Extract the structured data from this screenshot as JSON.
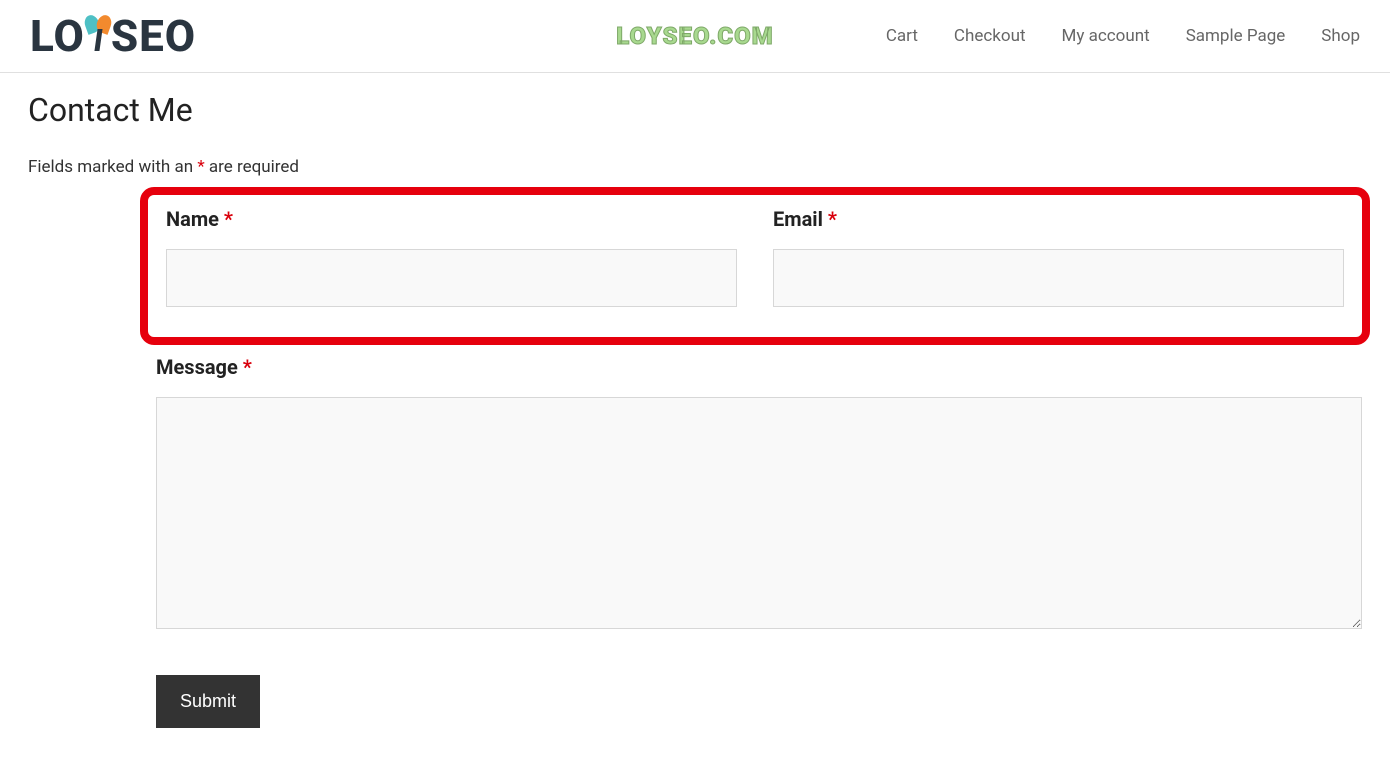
{
  "logo": {
    "part1": "LO",
    "part2": "SEO"
  },
  "watermark": "LOYSEO.COM",
  "nav": {
    "items": [
      {
        "label": "Cart"
      },
      {
        "label": "Checkout"
      },
      {
        "label": "My account"
      },
      {
        "label": "Sample Page"
      },
      {
        "label": "Shop"
      }
    ]
  },
  "page": {
    "title": "Contact Me",
    "required_note_prefix": "Fields marked with an ",
    "required_note_mark": "*",
    "required_note_suffix": " are required"
  },
  "form": {
    "name": {
      "label": "Name ",
      "req": "*",
      "value": ""
    },
    "email": {
      "label": "Email ",
      "req": "*",
      "value": ""
    },
    "message": {
      "label": "Message ",
      "req": "*",
      "value": ""
    },
    "submit_label": "Submit"
  }
}
